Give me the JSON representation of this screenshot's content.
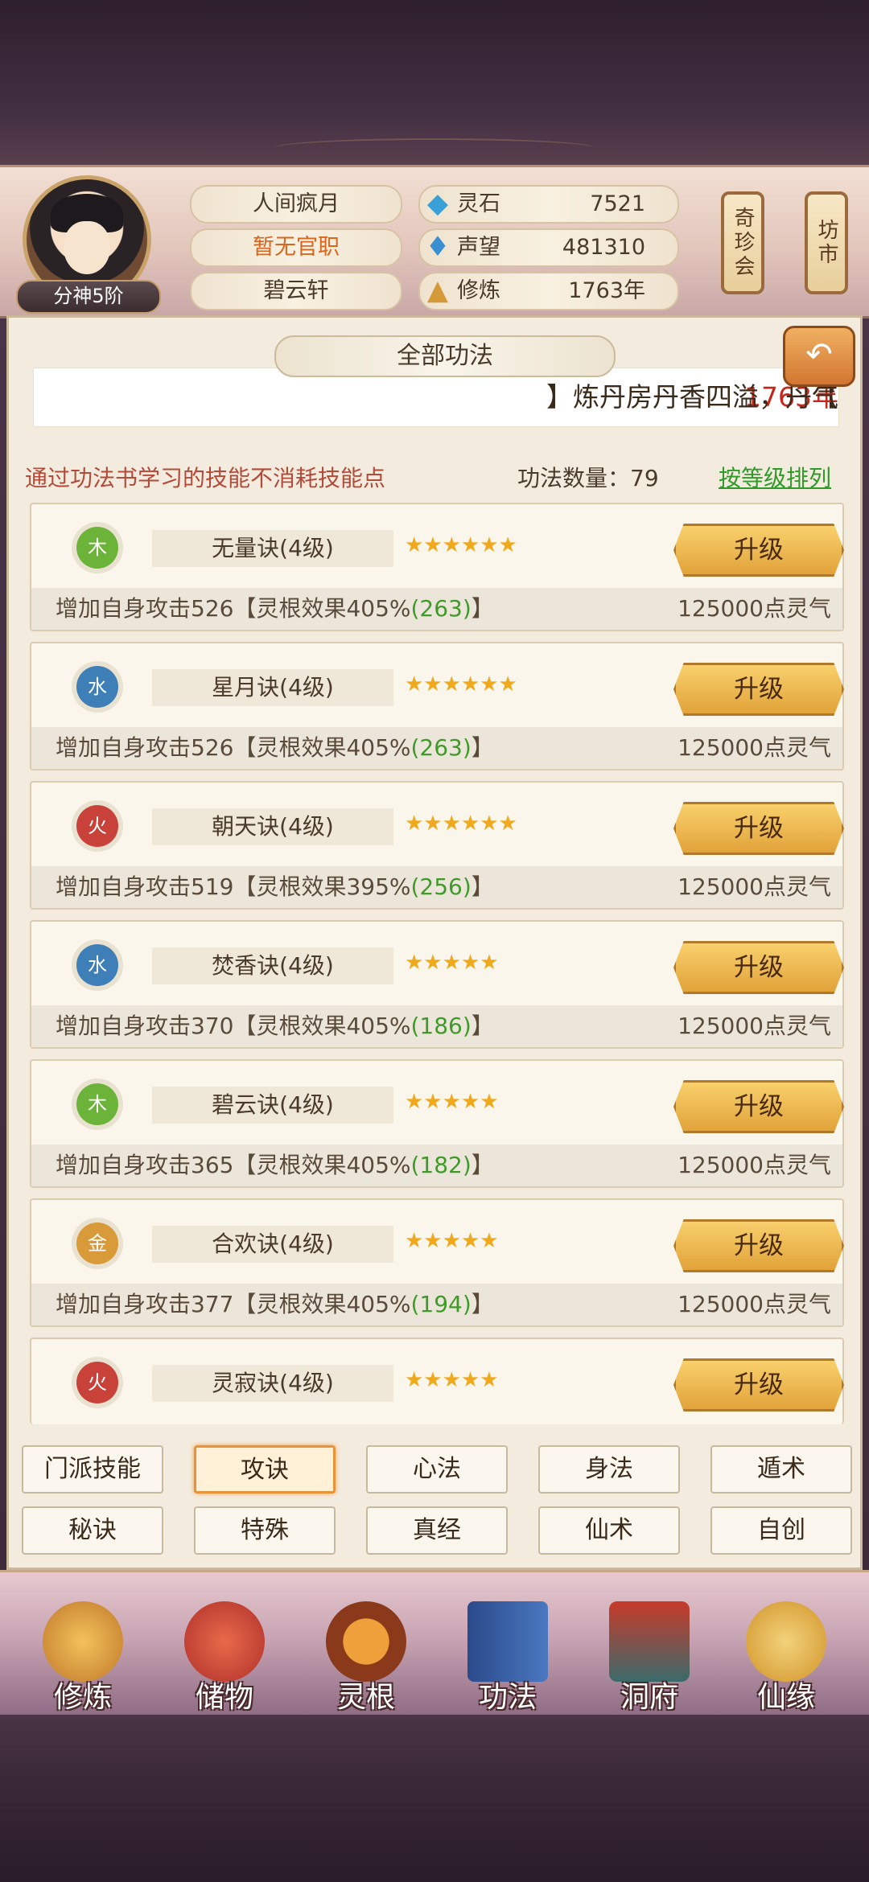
{
  "header": {
    "avatar_badge": "分神5阶",
    "name": "人间疯月",
    "official_rank": "暂无官职",
    "sect": "碧云轩",
    "stats": [
      {
        "icon": "spirit-stone-icon",
        "label": "灵石",
        "value": "7521"
      },
      {
        "icon": "prestige-icon",
        "label": "声望",
        "value": "481310"
      },
      {
        "icon": "cultivation-icon",
        "label": "修炼",
        "value": "1763年"
      }
    ],
    "side_buttons": [
      "奇珍会",
      "坊市"
    ]
  },
  "panel": {
    "title": "全部功法",
    "marquee": {
      "prefix": "【",
      "year": "1763年",
      "suffix": "】炼丹房丹香四溢，丹气"
    },
    "info_left": "通过功法书学习的技能不消耗技能点",
    "info_mid": "功法数量：79",
    "sort_link": "按等级排列"
  },
  "skills": [
    {
      "element": "木",
      "element_type": "wood",
      "name": "无量诀(4级)",
      "stars": 6,
      "upgrade": "升级",
      "desc_a": "增加自身攻击526【灵根效果405%",
      "desc_green": "(263)",
      "desc_b": "】",
      "cost": "125000点灵气"
    },
    {
      "element": "水",
      "element_type": "water",
      "name": "星月诀(4级)",
      "stars": 6,
      "upgrade": "升级",
      "desc_a": "增加自身攻击526【灵根效果405%",
      "desc_green": "(263)",
      "desc_b": "】",
      "cost": "125000点灵气"
    },
    {
      "element": "火",
      "element_type": "fire",
      "name": "朝天诀(4级)",
      "stars": 6,
      "upgrade": "升级",
      "desc_a": "增加自身攻击519【灵根效果395%",
      "desc_green": "(256)",
      "desc_b": "】",
      "cost": "125000点灵气"
    },
    {
      "element": "水",
      "element_type": "water",
      "name": "焚香诀(4级)",
      "stars": 5,
      "upgrade": "升级",
      "desc_a": "增加自身攻击370【灵根效果405%",
      "desc_green": "(186)",
      "desc_b": "】",
      "cost": "125000点灵气"
    },
    {
      "element": "木",
      "element_type": "wood",
      "name": "碧云诀(4级)",
      "stars": 5,
      "upgrade": "升级",
      "desc_a": "增加自身攻击365【灵根效果405%",
      "desc_green": "(182)",
      "desc_b": "】",
      "cost": "125000点灵气"
    },
    {
      "element": "金",
      "element_type": "metal",
      "name": "合欢诀(4级)",
      "stars": 5,
      "upgrade": "升级",
      "desc_a": "增加自身攻击377【灵根效果405%",
      "desc_green": "(194)",
      "desc_b": "】",
      "cost": "125000点灵气"
    },
    {
      "element": "火",
      "element_type": "fire",
      "name": "灵寂诀(4级)",
      "stars": 5,
      "upgrade": "升级"
    }
  ],
  "tabs_row1": [
    "门派技能",
    "攻诀",
    "心法",
    "身法",
    "遁术"
  ],
  "tabs_row2": [
    "秘诀",
    "特殊",
    "真经",
    "仙术",
    "自创"
  ],
  "active_tab": "攻诀",
  "bottom_nav": [
    {
      "label": "修炼",
      "icon": "meditation-icon"
    },
    {
      "label": "储物",
      "icon": "storage-bag-icon"
    },
    {
      "label": "灵根",
      "icon": "spirit-root-icon"
    },
    {
      "label": "功法",
      "icon": "skill-book-icon"
    },
    {
      "label": "洞府",
      "icon": "cave-residence-icon"
    },
    {
      "label": "仙缘",
      "icon": "fortune-gourd-icon"
    }
  ],
  "colors": {
    "accent_orange": "#e8923a",
    "green": "#3f9a2a",
    "red": "#c5271c"
  }
}
